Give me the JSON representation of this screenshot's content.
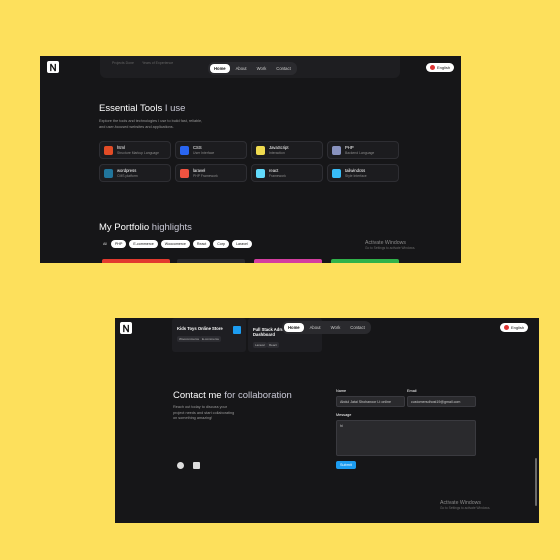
{
  "screenshot1": {
    "nav": {
      "items": [
        "Home",
        "About",
        "Work",
        "Contact"
      ],
      "active": "Home"
    },
    "topbar_ghost": [
      "Projects Done",
      "Years of Experience"
    ],
    "language": "English",
    "tools": {
      "title_main": "Essential Tools",
      "title_accent": "I use",
      "description": "Explore the tools and technologies I use to build fast, reliable, and user-focused websites and applications.",
      "items": [
        {
          "name": "html",
          "sub": "Structure Markup Language",
          "color": "#e34c26"
        },
        {
          "name": "CSS",
          "sub": "User Interface",
          "color": "#2965f1"
        },
        {
          "name": "JavaScript",
          "sub": "Interaction",
          "color": "#f0db4f"
        },
        {
          "name": "PHP",
          "sub": "Backend Language",
          "color": "#8892be"
        },
        {
          "name": "wordpress",
          "sub": "CMS platform",
          "color": "#21759b"
        },
        {
          "name": "laravel",
          "sub": "PHP Framework",
          "color": "#f05340"
        },
        {
          "name": "react",
          "sub": "Framework",
          "color": "#61dafb"
        },
        {
          "name": "tailwindcss",
          "sub": "Style Interface",
          "color": "#38bdf8"
        }
      ]
    },
    "portfolio": {
      "title_main": "My Portfolio",
      "title_accent": "highlights",
      "filters": [
        "All",
        "PHP",
        "E-commerce",
        "Woocomerce",
        "React",
        "Corp",
        "Laravel"
      ],
      "active_filter": "All"
    },
    "watermark": {
      "line1": "Activate Windows",
      "line2": "Go to Settings to activate Windows."
    }
  },
  "screenshot2": {
    "nav": {
      "items": [
        "Home",
        "About",
        "Work",
        "Contact"
      ],
      "active": "Home"
    },
    "language": "English",
    "projects": [
      {
        "title": "Kids Toys Online Store",
        "tags": [
          "Woocommerce",
          "E-commerce"
        ]
      },
      {
        "title": "Full Stack Admin Dashboard",
        "tags": [
          "Laravel",
          "React"
        ]
      }
    ],
    "contact": {
      "title_main": "Contact me",
      "title_accent": "for collaboration",
      "description": "Reach out today to discuss your project needs and start collaborating on something amazing!",
      "name_label": "Name",
      "name_value": "Abdul Jatai Shohanoor Lt online",
      "email_label": "Email",
      "email_value": "customersdhost19@gmail.com",
      "message_label": "Message",
      "message_value": "hi",
      "submit": "Submit"
    },
    "watermark": {
      "line1": "Activate Windows",
      "line2": "Go to Settings to activate Windows."
    }
  }
}
